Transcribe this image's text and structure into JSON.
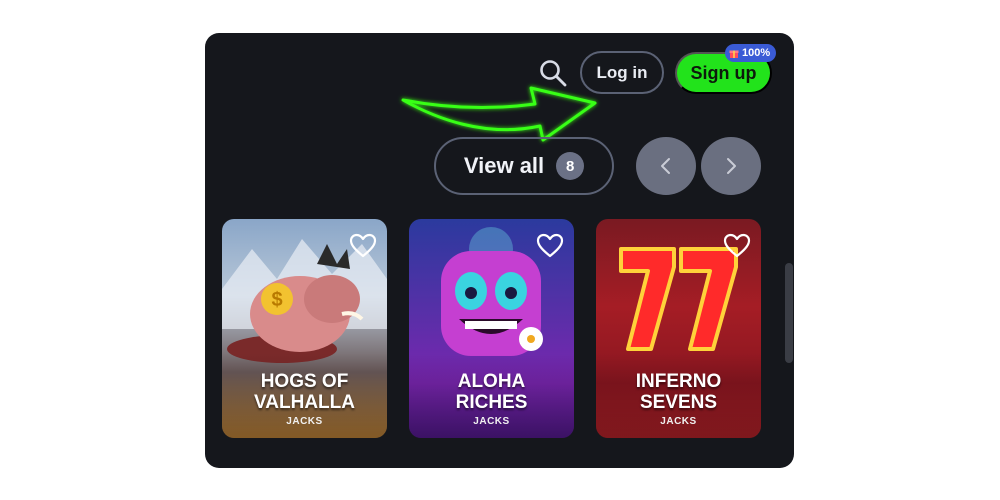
{
  "header": {
    "search_icon": "search-icon",
    "login_label": "Log in",
    "signup_label": "Sign up",
    "bonus_badge": "100%",
    "bonus_icon": "gift-icon"
  },
  "section": {
    "view_all_label": "View all",
    "view_all_count": "8",
    "prev_icon": "chevron-left-icon",
    "next_icon": "chevron-right-icon"
  },
  "games": [
    {
      "title_line1": "HOGS OF",
      "title_line2": "VALHALLA",
      "provider": "JACKS"
    },
    {
      "title_line1": "ALOHA",
      "title_line2": "RICHES",
      "provider": "JACKS"
    },
    {
      "title_line1": "INFERNO",
      "title_line2": "SEVENS",
      "provider": "JACKS"
    }
  ],
  "colors": {
    "background": "#15171c",
    "signup": "#22e31b",
    "badge": "#3a5bd6",
    "arrow": "#39ff14"
  }
}
